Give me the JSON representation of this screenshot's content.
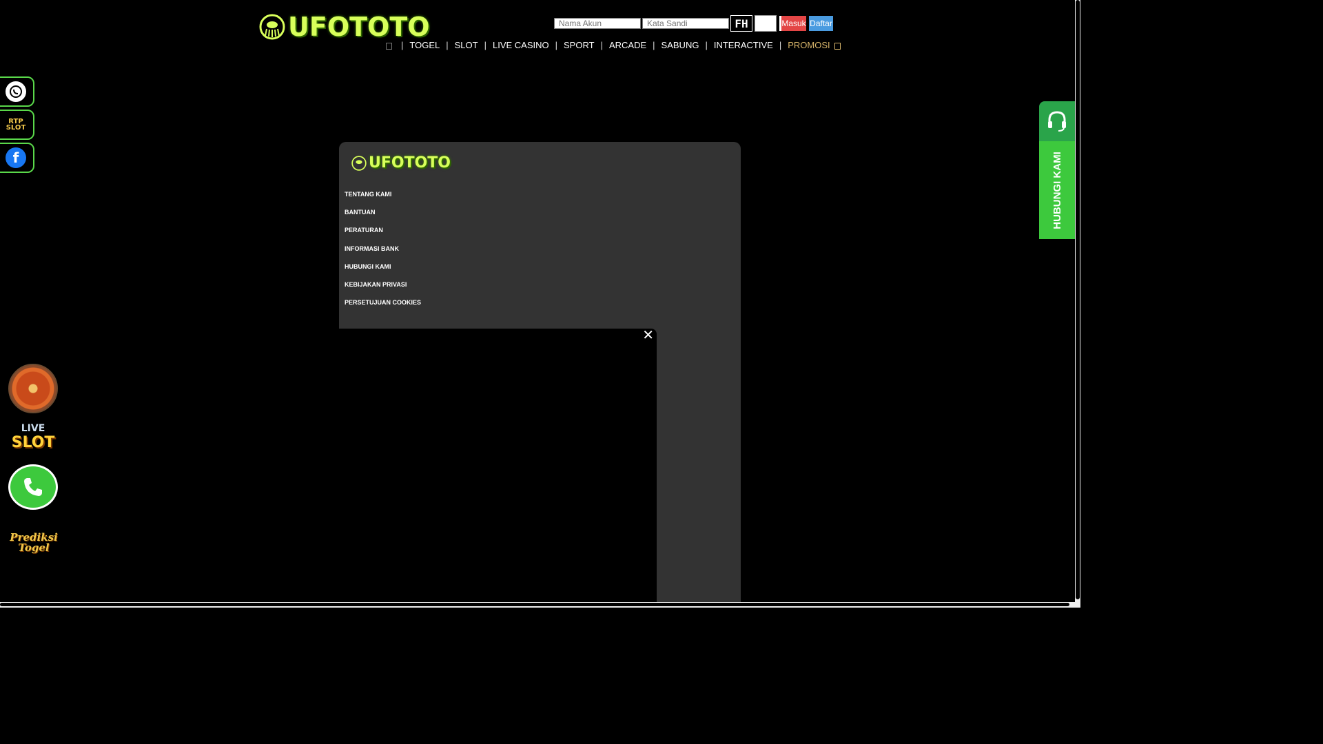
{
  "brand": {
    "name": "UFOTOTO",
    "accent": "#d8ff5a"
  },
  "login": {
    "username_placeholder": "Nama Akun",
    "password_placeholder": "Kata Sandi",
    "captcha_text": "FH",
    "login_label": "Masuk",
    "register_label": "Daftar"
  },
  "nav": {
    "items": [
      "TOGEL",
      "SLOT",
      "LIVE CASINO",
      "SPORT",
      "ARCADE",
      "SABUNG",
      "INTERACTIVE"
    ],
    "promo": "PROMOSI"
  },
  "sidebar": {
    "socials": [
      "whatsapp-icon",
      "rtp-slot-icon",
      "facebook-icon"
    ],
    "rtp_label": "RTP SLOT",
    "live_slot": {
      "line1": "LIVE",
      "line2": "SLOT"
    },
    "prediksi": {
      "line1": "Prediksi",
      "line2": "Togel"
    }
  },
  "contact": {
    "label": "HUBUNGI KAMI"
  },
  "footer": {
    "links": [
      "TENTANG KAMI",
      "BANTUAN",
      "PERATURAN",
      "INFORMASI BANK",
      "HUBUNGI KAMI",
      "KEBIJAKAN PRIVASI",
      "PERSETUJUAN COOKIES"
    ]
  },
  "colors": {
    "green": "#3dc93d",
    "login_red": "#e34545",
    "register_blue": "#4a9be0",
    "promo_gold": "#d8b56a"
  }
}
